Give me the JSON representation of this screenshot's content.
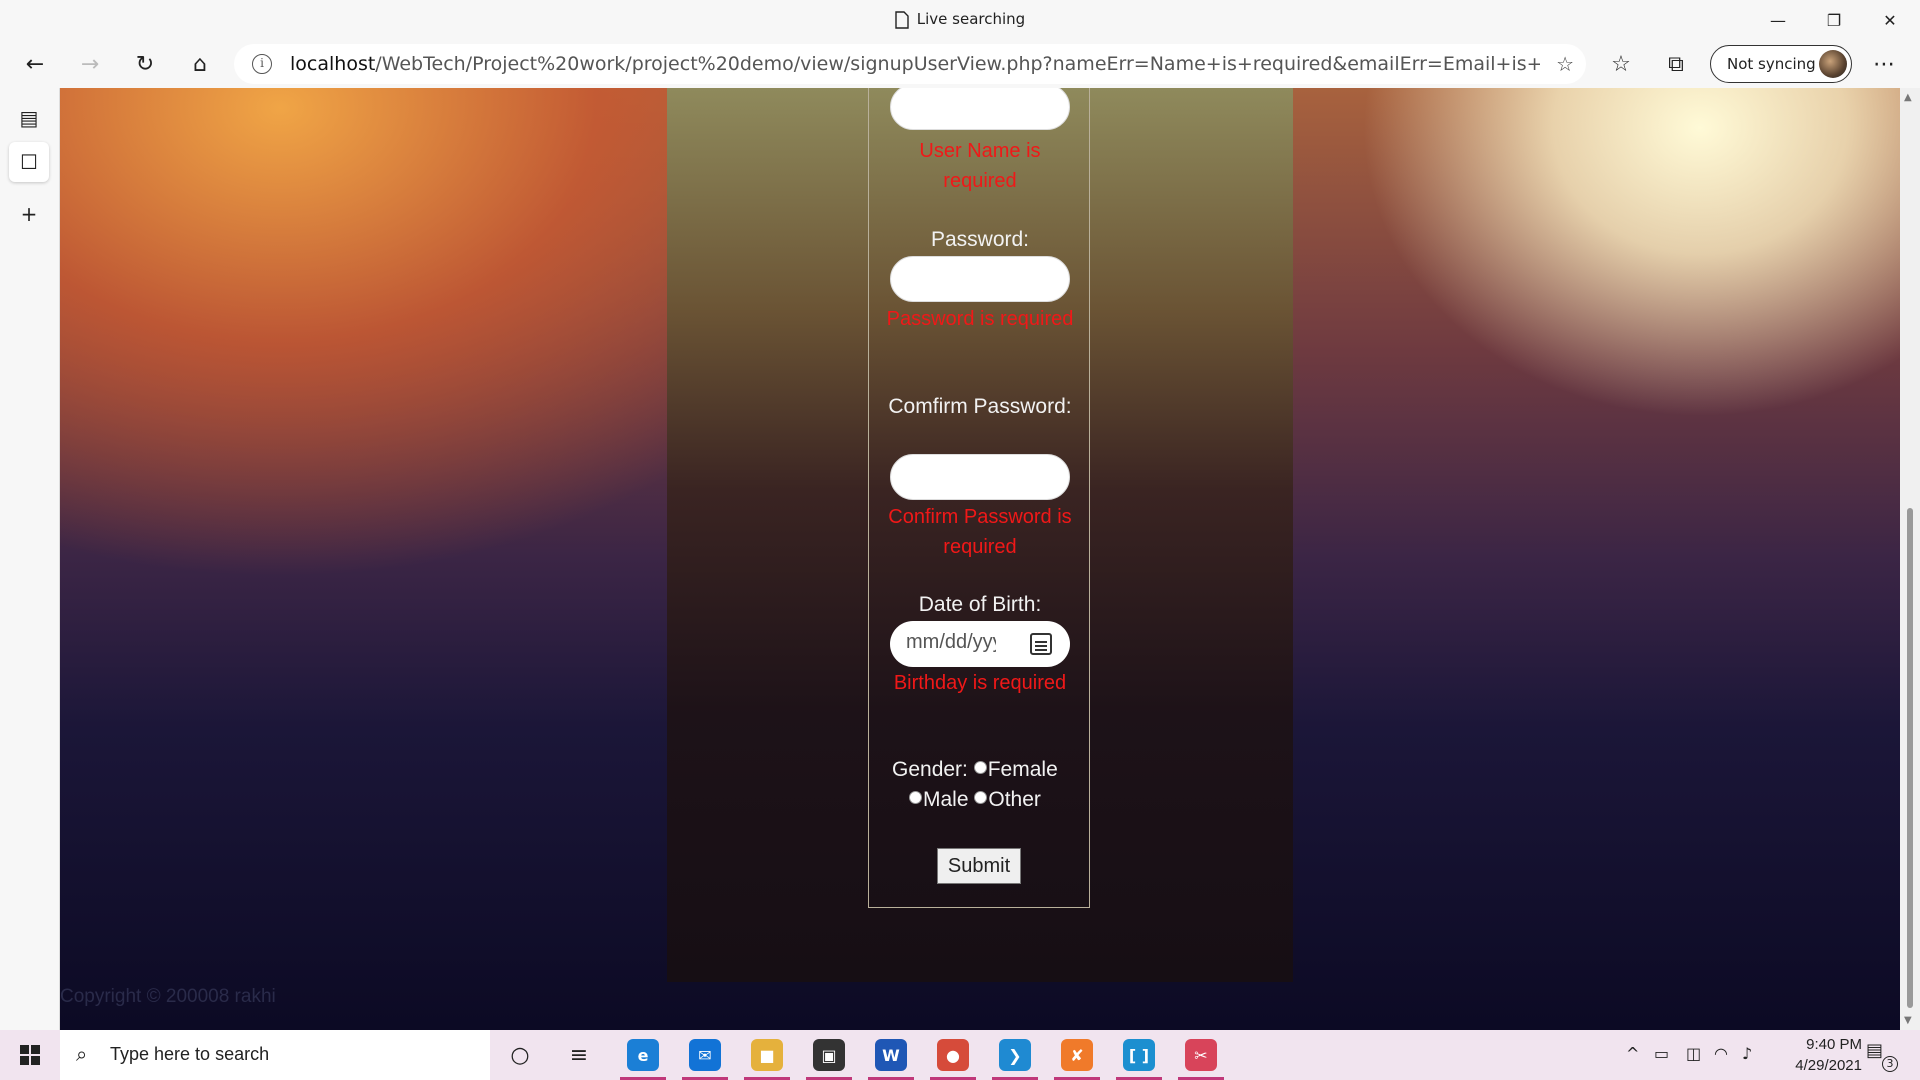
{
  "window": {
    "tab_title": "Live searching",
    "minimize_glyph": "—",
    "restore_glyph": "❐",
    "close_glyph": "✕"
  },
  "nav": {
    "back_glyph": "←",
    "forward_glyph": "→",
    "refresh_glyph": "↻",
    "home_glyph": "⌂",
    "url_host": "localhost",
    "url_path": "/WebTech/Project%20work/project%20demo/view/signupUserView.php?nameErr=Name+is+required&emailErr=Email+is+require...",
    "favorites_glyph": "☆",
    "collections_glyph": "⧉",
    "sync_label": "Not syncing",
    "more_glyph": "⋯"
  },
  "sidebar": {
    "tabs_glyph": "▤",
    "page_glyph": "☐",
    "add_glyph": "+"
  },
  "form": {
    "username_error": "User Name is required",
    "password_label": "Password:",
    "password_error": "Password is required",
    "confirm_label": "Comfirm Password:",
    "confirm_error": "Confirm Password is required",
    "dob_label": "Date of Birth:",
    "dob_placeholder": "mm/dd/yyyy",
    "dob_error": "Birthday is required",
    "gender_label": "Gender:",
    "gender_options": [
      "Female",
      "Male",
      "Other"
    ],
    "submit_label": "Submit"
  },
  "footer": {
    "copyright": "Copyright © 200008 rakhi"
  },
  "taskbar": {
    "search_placeholder": "Type here to search",
    "search_glyph": "⌕",
    "cortana_glyph": "○",
    "taskview_glyph": "≡",
    "apps": [
      {
        "name": "edge",
        "letter": "e",
        "color": "#1b7fd6"
      },
      {
        "name": "mail",
        "letter": "✉",
        "color": "#1273d6"
      },
      {
        "name": "file-explorer",
        "letter": "■",
        "color": "#e5b13c"
      },
      {
        "name": "store",
        "letter": "▣",
        "color": "#333333"
      },
      {
        "name": "word",
        "letter": "W",
        "color": "#1f57b5"
      },
      {
        "name": "chrome",
        "letter": "●",
        "color": "#d64b3a"
      },
      {
        "name": "vscode",
        "letter": "❯",
        "color": "#1f8ad2"
      },
      {
        "name": "xampp",
        "letter": "✘",
        "color": "#f07a2a"
      },
      {
        "name": "app-bracket",
        "letter": "[ ]",
        "color": "#1c8fd0"
      },
      {
        "name": "snip",
        "letter": "✂",
        "color": "#d8445a"
      }
    ],
    "tray_chevron": "^",
    "time": "9:40 PM",
    "date": "4/29/2021",
    "notification_count": "3"
  }
}
